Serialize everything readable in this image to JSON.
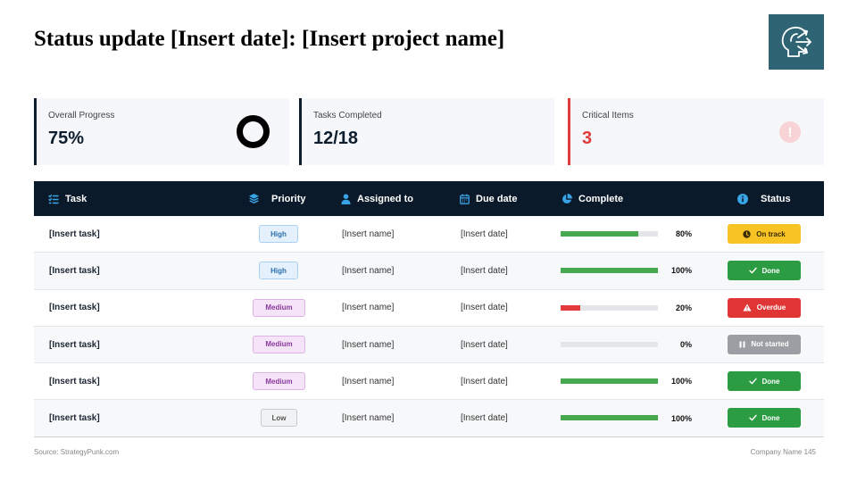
{
  "title": "Status update [Insert date]: [Insert project name]",
  "colors": {
    "header_bg": "#0b1a2b",
    "logo_bg": "#2f6474",
    "accent_red": "#e23b3b",
    "green": "#2c9c43",
    "yellow": "#f7c325",
    "gray": "#9b9ea3",
    "header_icon": "#38a4e6"
  },
  "logo": {
    "icon": "head-arrows-icon"
  },
  "kpis": [
    {
      "label": "Overall Progress",
      "value": "75%",
      "icon": "donut-ring-icon"
    },
    {
      "label": "Tasks Completed",
      "value": "12/18"
    },
    {
      "label": "Critical Items",
      "value": "3",
      "icon": "exclamation-circle-icon"
    }
  ],
  "table": {
    "headers": {
      "task": "Task",
      "priority": "Priority",
      "assigned": "Assigned to",
      "due": "Due date",
      "complete": "Complete",
      "status": "Status"
    },
    "rows": [
      {
        "task": "[Insert task]",
        "priority": "High",
        "assigned": "[Insert name]",
        "due": "[Insert date]",
        "progress": 80,
        "percent_label": "80%",
        "status": "On track",
        "status_icon": "clock-icon"
      },
      {
        "task": "[Insert task]",
        "priority": "High",
        "assigned": "[Insert name]",
        "due": "[Insert date]",
        "progress": 100,
        "percent_label": "100%",
        "status": "Done",
        "status_icon": "check-icon"
      },
      {
        "task": "[Insert task]",
        "priority": "Medium",
        "assigned": "[Insert name]",
        "due": "[Insert date]",
        "progress": 20,
        "percent_label": "20%",
        "status": "Overdue",
        "status_icon": "warning-icon"
      },
      {
        "task": "[Insert task]",
        "priority": "Medium",
        "assigned": "[Insert name]",
        "due": "[Insert date]",
        "progress": 0,
        "percent_label": "0%",
        "status": "Not started",
        "status_icon": "pause-icon"
      },
      {
        "task": "[Insert task]",
        "priority": "Medium",
        "assigned": "[Insert name]",
        "due": "[Insert date]",
        "progress": 100,
        "percent_label": "100%",
        "status": "Done",
        "status_icon": "check-icon"
      },
      {
        "task": "[Insert task]",
        "priority": "Low",
        "assigned": "[Insert name]",
        "due": "[Insert date]",
        "progress": 100,
        "percent_label": "100%",
        "status": "Done",
        "status_icon": "check-icon"
      }
    ]
  },
  "source": "Source: StrategyPunk.com",
  "footer": "Company Name 145"
}
